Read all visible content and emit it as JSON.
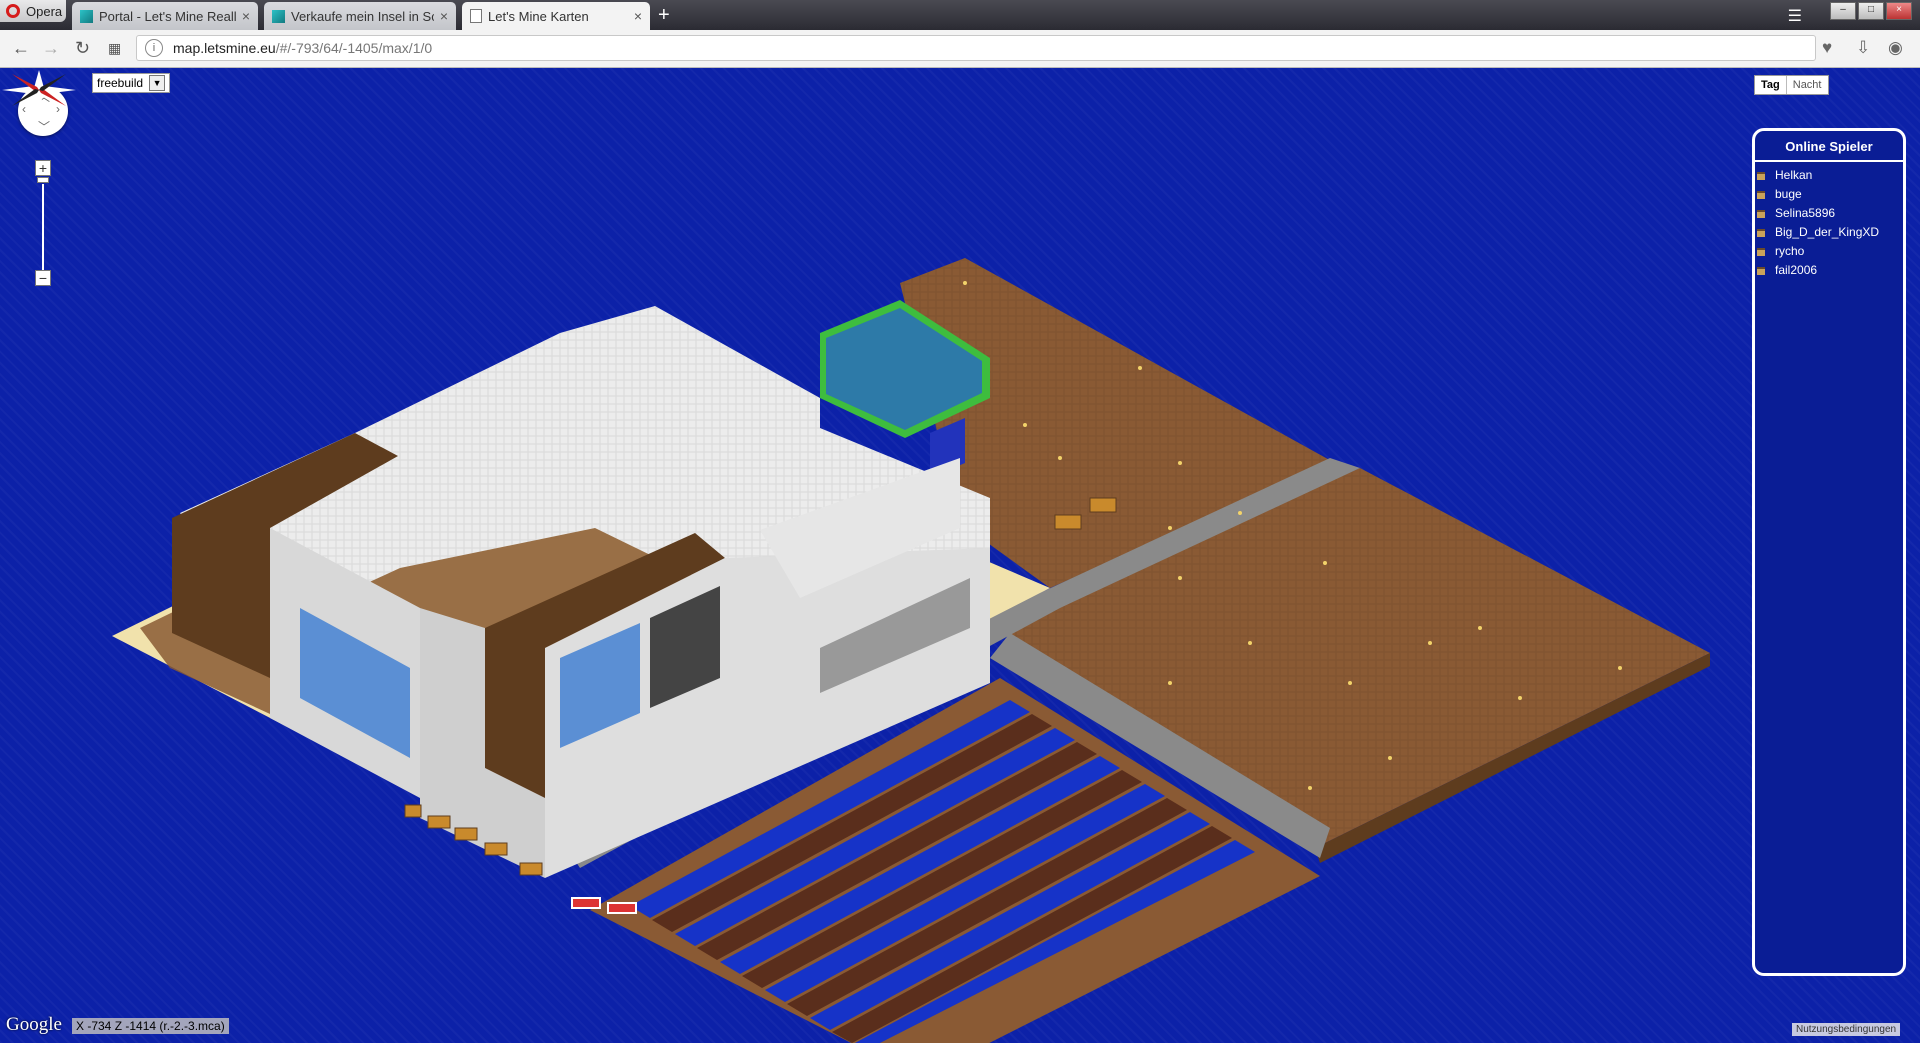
{
  "browser": {
    "opera_label": "Opera",
    "tabs": [
      {
        "label": "Portal - Let's Mine Reallife",
        "close": "×"
      },
      {
        "label": "Verkaufe mein Insel in Schl",
        "close": "×"
      },
      {
        "label": "Let's Mine Karten",
        "close": "×"
      }
    ],
    "new_tab": "+",
    "url_domain": "map.letsmine.eu",
    "url_path": "/#/-793/64/-1405/max/1/0",
    "url_info": "i"
  },
  "map": {
    "world_select": "freebuild",
    "day_label": "Tag",
    "night_label": "Nacht",
    "zoom_in": "+",
    "zoom_out": "−",
    "players_title": "Online Spieler",
    "players": [
      "Helkan",
      "buge",
      "Selina5896",
      "Big_D_der_KingXD",
      "rycho",
      "fail2006"
    ],
    "google_logo": "Google",
    "coords_text": "X -734 Z -1414 (r.-2.-3.mca)",
    "terms": "Nutzungsbedingungen"
  },
  "colors": {
    "water": "#0c21a8",
    "snow": "#ececec",
    "dirt": "#8a5a34",
    "wood": "#5e3c1e",
    "sand": "#f1e2ac",
    "gravel": "#8a8a8a",
    "glass": "#5b8fd4",
    "grass": "#3ebd3e"
  }
}
